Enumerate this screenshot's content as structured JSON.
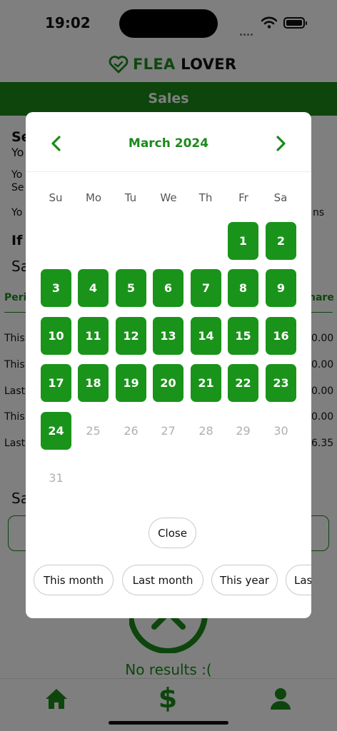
{
  "status": {
    "time": "19:02"
  },
  "app": {
    "logo_text_1": "FLEA",
    "logo_text_2": "LOVER"
  },
  "page": {
    "header": "Sales",
    "bg_lines": [
      "Se",
      "Yo",
      "Yo",
      "Se",
      "Yo",
      "ns",
      "If",
      "Sa",
      "Peri",
      "hare",
      "This",
      "0.00",
      "This",
      "0.00",
      "Last",
      "0.00",
      "This",
      "0.00",
      "Last",
      "6.35",
      "Sa"
    ],
    "no_results": "No results :("
  },
  "calendar": {
    "month_title": "March 2024",
    "weekdays": [
      "Su",
      "Mo",
      "Tu",
      "We",
      "Th",
      "Fr",
      "Sa"
    ],
    "days": [
      "1",
      "2",
      "3",
      "4",
      "5",
      "6",
      "7",
      "8",
      "9",
      "10",
      "11",
      "12",
      "13",
      "14",
      "15",
      "16",
      "17",
      "18",
      "19",
      "20",
      "21",
      "22",
      "23",
      "24",
      "25",
      "26",
      "27",
      "28",
      "29",
      "30",
      "31"
    ],
    "selectable_up_to": 24,
    "close_label": "Close",
    "presets": [
      "This month",
      "Last month",
      "This year",
      "Las"
    ],
    "accent": "#1a931a"
  }
}
